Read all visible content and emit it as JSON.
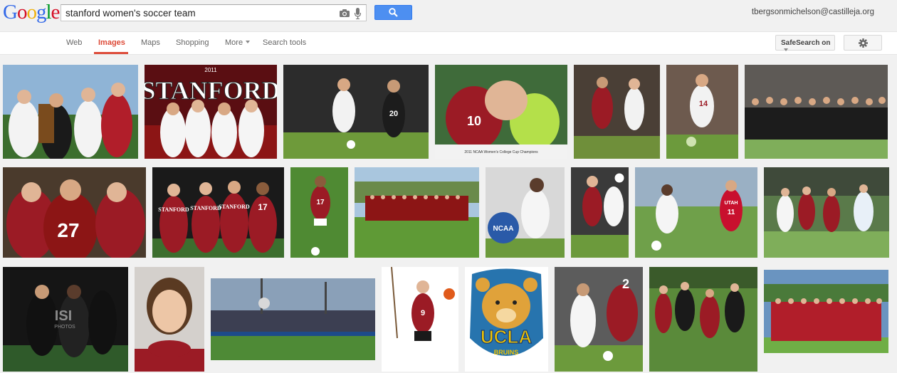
{
  "header": {
    "logo_letters": [
      "G",
      "o",
      "o",
      "g",
      "l",
      "e"
    ],
    "search_query": "stanford women's soccer team",
    "account_email": "tbergsonmichelson@castilleja.org"
  },
  "tabs": [
    {
      "label": "Web"
    },
    {
      "label": "Images",
      "active": true
    },
    {
      "label": "Maps"
    },
    {
      "label": "Shopping"
    },
    {
      "label": "More"
    },
    {
      "label": "Search tools"
    }
  ],
  "toolbar": {
    "safesearch_label": "SafeSearch on",
    "settings_icon": "gear-icon"
  },
  "colors": {
    "accent_red": "#dd4b39",
    "search_blue": "#4d8ff1",
    "stanford_cardinal": "#8c1515",
    "ucla_blue": "#2774ae",
    "ucla_gold": "#f2a900"
  },
  "thumbnails": [
    {
      "name": "thumb-trophy-celebration",
      "text": []
    },
    {
      "name": "thumb-stanford-team-poster",
      "text": [
        "STANFORD",
        "2011"
      ]
    },
    {
      "name": "thumb-match-action-1",
      "text": [
        "20"
      ]
    },
    {
      "name": "thumb-tv-celebration",
      "text": [
        "10",
        "2011 NCAA Women's College Cup Champions"
      ]
    },
    {
      "name": "thumb-player-running",
      "text": []
    },
    {
      "name": "thumb-player-kicking-14",
      "text": [
        "14"
      ]
    },
    {
      "name": "thumb-team-with-trophy",
      "text": []
    },
    {
      "name": "thumb-team-hug-27",
      "text": [
        "27"
      ]
    },
    {
      "name": "thumb-four-players-jerseys",
      "text": [
        "STANFORD",
        "STANFORD",
        "STANFORD",
        "17"
      ]
    },
    {
      "name": "thumb-player-17-dribbling",
      "text": [
        "17"
      ]
    },
    {
      "name": "thumb-team-photo-field",
      "text": []
    },
    {
      "name": "thumb-ncaa-hug",
      "text": [
        "NCAA"
      ]
    },
    {
      "name": "thumb-player-heading",
      "text": []
    },
    {
      "name": "thumb-stanford-vs-utah",
      "text": [
        "UTAH",
        "11"
      ]
    },
    {
      "name": "thumb-match-action-group",
      "text": []
    },
    {
      "name": "thumb-night-celebration",
      "text": [
        "ISI",
        "PHOTOS"
      ]
    },
    {
      "name": "thumb-player-portrait",
      "text": []
    },
    {
      "name": "thumb-stadium-view",
      "text": []
    },
    {
      "name": "thumb-lacrosse-player-9",
      "text": [
        "9"
      ]
    },
    {
      "name": "thumb-ucla-bruins-logo",
      "text": [
        "UCLA",
        "BRUINS"
      ]
    },
    {
      "name": "thumb-goal-action",
      "text": [
        "2"
      ]
    },
    {
      "name": "thumb-players-scramble",
      "text": []
    },
    {
      "name": "thumb-team-photo-red",
      "text": []
    }
  ]
}
